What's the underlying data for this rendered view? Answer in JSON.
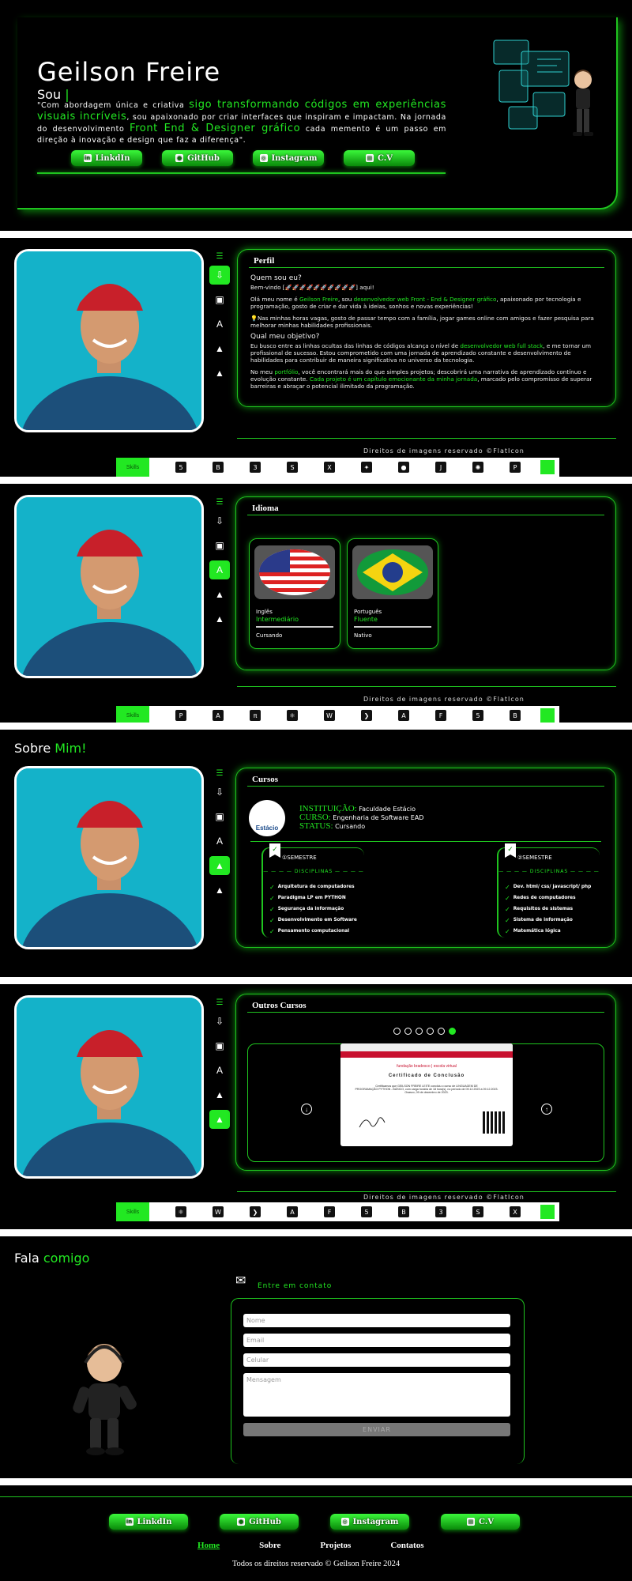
{
  "hero": {
    "name": "Geilson Freire",
    "sou": "Sou",
    "cursor": "|",
    "bio": {
      "part1": "\"Com abordagem única e criativa ",
      "hl1": "sigo transformando códigos em experiências visuais incríveis",
      "part2": ", sou apaixonado por criar interfaces que inspiram e impactam. Na jornada do desenvolvimento ",
      "hl2": "Front End & Designer gráfico",
      "part3": " cada memento é um passo em direção à inovação e design que faz a diferença\"."
    },
    "buttons": [
      {
        "label": "LinkdIn",
        "icon": "in"
      },
      {
        "label": "GitHub",
        "icon": "●"
      },
      {
        "label": "Instagram",
        "icon": "◎"
      },
      {
        "label": "C.V",
        "icon": "▤"
      }
    ]
  },
  "credits": "Direitos de imagens reservado ©FlatIcon",
  "skills_first": "Skills",
  "sidebar_icons": [
    "download-icon",
    "briefcase-icon",
    "translate-icon",
    "graduation-cap-icon",
    "graduation-cap-icon"
  ],
  "perfil": {
    "title": "Perfil",
    "q1": "Quem sou eu?",
    "welcome": "Bem-vindo [🚀🚀🚀🚀🚀🚀🚀🚀🚀🚀] aqui!",
    "p1a": "Olá meu nome é ",
    "p1name": "Geilson Freire",
    "p1b": ", sou ",
    "p1role": "desenvolvedor web Front - End & Designer gráfico",
    "p1c": ", apaixonado por tecnologia e programação, gosto de criar e dar vida à ideias, sonhos e novas experiências!",
    "p2": "💡Nas minhas horas vagas, gosto de passar tempo com a família, jogar games online com amigos e fazer pesquisa para melhorar minhas habilidades profissionais.",
    "q2": "Qual meu objetivo?",
    "p3a": "Eu busco entre as linhas ocultas das linhas de códigos alcança o nível de ",
    "p3hl": "desenvolvedor web full stack",
    "p3b": ", e me tornar um profissional de sucesso. Estou comprometido com uma jornada de aprendizado constante e desenvolvimento de habilidades para contribuir de maneira significativa no universo da tecnologia.",
    "p4a": "No meu ",
    "p4hl1": "portfólio",
    "p4b": ", você encontrará mais do que simples projetos; descobrirá uma narrativa de aprendizado contínuo e evolução constante. ",
    "p4hl2": "Cada projeto é um capítulo emocionante da minha jornada",
    "p4c": ", marcado pelo compromisso de superar barreiras e abraçar o potencial ilimitado da programação."
  },
  "idioma": {
    "title": "Idioma",
    "cards": [
      {
        "name": "Inglês",
        "level": "Intermediário",
        "status": "Cursando",
        "flag": "usa-flag"
      },
      {
        "name": "Português",
        "level": "Fluente",
        "status": "Nativo",
        "flag": "brazil-flag"
      }
    ]
  },
  "sobre_title": {
    "a": "Sobre ",
    "b": "Mim!"
  },
  "cursos": {
    "title": "Cursos",
    "logo_text": "Estácio",
    "inst_label": "INSTITUIÇÃO:",
    "inst_value": "Faculdade Estácio",
    "curso_label": "CURSO:",
    "curso_value": "Engenharia de Software EAD",
    "status_label": "STATUS:",
    "status_value": "Cursando",
    "semesters": [
      {
        "num": "1",
        "label": "SEMESTRE",
        "disc": "DISCIPLINAS",
        "items": [
          "Arquitetura de computadores",
          "Paradigma LP em PYTHON",
          "Segurança da informação",
          "Desenvolvimento em Software",
          "Pensamento computacional"
        ]
      },
      {
        "num": "2",
        "label": "SEMESTRE",
        "disc": "DISCIPLINAS",
        "items": [
          "Dev. html/ css/ javascript/ php",
          "Redes de computadores",
          "Requisitos de sistemas",
          "Sistema de informação",
          "Matemática lógica"
        ]
      }
    ]
  },
  "outros": {
    "title": "Outros Cursos",
    "dots": 6,
    "active_dot": 6,
    "cert": {
      "brand": "fundação bradesco | escola virtual",
      "heading": "Certificado de Conclusão",
      "body1": "Certificamos que GEILSON FREIRE LEITE concluiu o curso de LINGUAGEM DE",
      "body2": "PROGRAMAÇÃO PYTHON - BÁSICO, com carga horária de 18 hora(s), no período de 09.12.2023 a 09.12.2023.",
      "date": "Osasco, 09 de dezembro de 2023."
    }
  },
  "contato": {
    "title_a": "Fala ",
    "title_b": "comigo",
    "sub": "Entre em contato",
    "placeholders": [
      "Nome",
      "Email",
      "Celular",
      "Mensagem"
    ],
    "send": "ENVIAR"
  },
  "footer": {
    "nav": [
      "Home",
      "Sobre",
      "Projetos",
      "Contatos"
    ],
    "copyright": "Todos os direitos reservado © Geilson Freire 2024"
  },
  "colors": {
    "accent": "#22e822",
    "photo_bg": "#14b2c9"
  }
}
